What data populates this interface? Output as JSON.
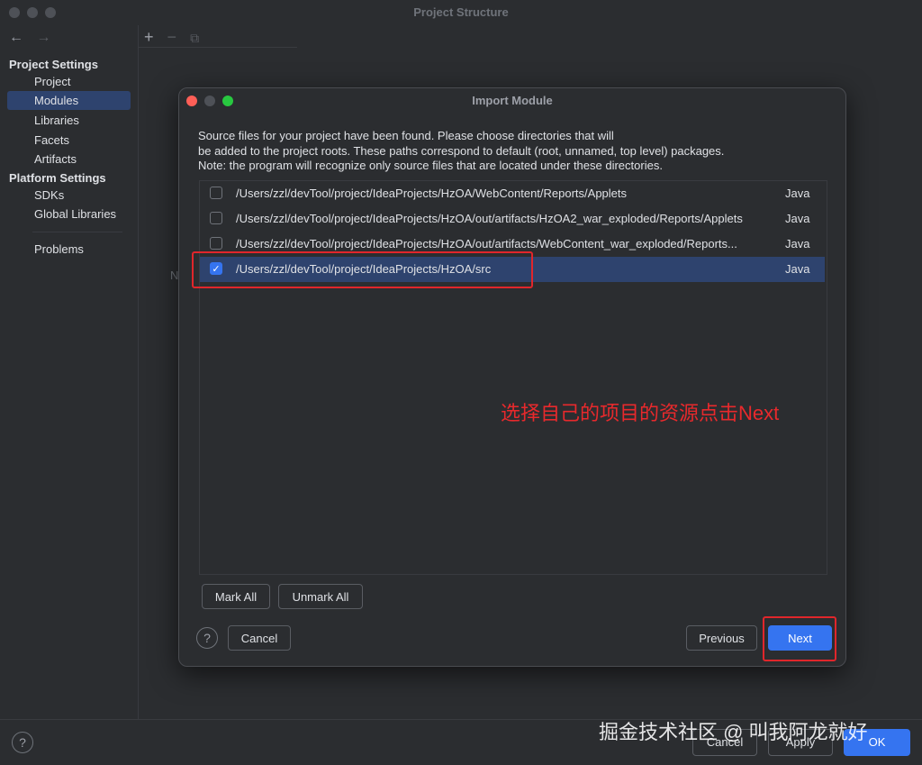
{
  "window": {
    "title": "Project Structure"
  },
  "nav": {
    "back": "←",
    "forward": "→"
  },
  "sidebar": {
    "project_settings_header": "Project Settings",
    "project_items": [
      "Project",
      "Modules",
      "Libraries",
      "Facets",
      "Artifacts"
    ],
    "platform_settings_header": "Platform Settings",
    "platform_items": [
      "SDKs",
      "Global Libraries"
    ],
    "problems": "Problems"
  },
  "toolbar": {
    "add": "+",
    "remove": "−",
    "copy": "⧉"
  },
  "middle_stub": "N",
  "dialog": {
    "title": "Import Module",
    "description": [
      "Source files for your project have been found. Please choose directories that will",
      "be added to the project roots. These paths correspond to default (root, unnamed, top level) packages.",
      "Note: the program will recognize only source files that are located under these directories."
    ],
    "rows": [
      {
        "path": "/Users/zzl/devTool/project/IdeaProjects/HzOA/WebContent/Reports/Applets",
        "lang": "Java",
        "checked": false
      },
      {
        "path": "/Users/zzl/devTool/project/IdeaProjects/HzOA/out/artifacts/HzOA2_war_exploded/Reports/Applets",
        "lang": "Java",
        "checked": false
      },
      {
        "path": "/Users/zzl/devTool/project/IdeaProjects/HzOA/out/artifacts/WebContent_war_exploded/Reports...",
        "lang": "Java",
        "checked": false
      },
      {
        "path": "/Users/zzl/devTool/project/IdeaProjects/HzOA/src",
        "lang": "Java",
        "checked": true
      }
    ],
    "mark_all": "Mark All",
    "unmark_all": "Unmark All",
    "help": "?",
    "cancel": "Cancel",
    "previous": "Previous",
    "next": "Next",
    "checkmark": "✓"
  },
  "annotation": "选择自己的项目的资源点击Next",
  "bottom": {
    "help": "?",
    "cancel": "Cancel",
    "apply": "Apply",
    "ok": "OK"
  },
  "watermark": "掘金技术社区 @ 叫我阿龙就好",
  "colors": {
    "accent": "#3574f0",
    "highlight": "#e0262b",
    "selection": "#2e436e"
  }
}
